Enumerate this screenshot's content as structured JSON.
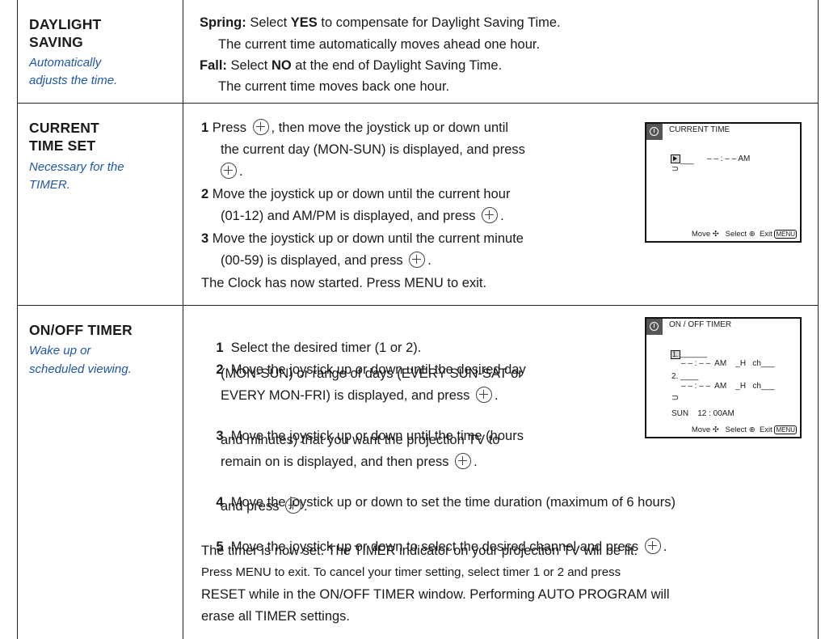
{
  "rows": {
    "daylight": {
      "title1": "DAYLIGHT",
      "title2": "SAVING",
      "sub1": "Automatically",
      "sub2": "adjusts the time.",
      "spring_label": "Spring:",
      "spring_a": " Select ",
      "spring_yes": "YES",
      "spring_b": " to compensate for Daylight Saving Time.",
      "spring_line2": "The current time automatically moves ahead one hour.",
      "fall_label": "Fall:",
      "fall_a": " Select ",
      "fall_no": "NO",
      "fall_b": " at the end of Daylight Saving Time.",
      "fall_line2": "The current time moves back one hour."
    },
    "current_time": {
      "title1": "CURRENT",
      "title2": "TIME SET",
      "sub1": "Necessary for the",
      "sub2": "TIMER.",
      "s1_num": "1",
      "s1_a": " Press ",
      "s1_b": ", then move the joystick up or down until",
      "s1_line2": "the current day (MON-SUN) is displayed, and press",
      "s1_line3": ".",
      "s2_num": "2",
      "s2_a": " Move the joystick up or down until the current hour",
      "s2_line2": "(01-12) and AM/PM is displayed, and press ",
      "s2_end": ".",
      "s3_num": "3",
      "s3_a": " Move the joystick up or down until the current minute",
      "s3_line2": "(00-59) is displayed, and press ",
      "s3_end": ".",
      "final": "The Clock has now started. Press MENU to exit.",
      "osd": {
        "title": "CURRENT TIME",
        "day": "___",
        "time": "– –  : – – AM",
        "return_glyph": "⊃",
        "move": "Move",
        "select": "Select",
        "exit": "Exit",
        "menu": "MENU"
      }
    },
    "onoff": {
      "title1": "ON/OFF TIMER",
      "sub1": "Wake up or",
      "sub2": "scheduled viewing.",
      "s1_num": "1",
      "s1_a": "  Select the desired timer (1 or 2).",
      "s2_num": "2",
      "s2_a": "  Move the joystick up or down until the desired day",
      "s2_line2": "(MON-SUN) or range of days (EVERY SUN-SAT or",
      "s2_line3": "EVERY MON-FRI) is displayed, and press ",
      "s2_end": ".",
      "s3_num": "3",
      "s3_a": "  Move the joystick up or down until the time (hours",
      "s3_line2": "and minutes) that you want the projection TV to",
      "s3_line3": "remain on is displayed, and then press ",
      "s3_end": ".",
      "s4_num": "4",
      "s4_a": "  Move the joystick up or down to set the time duration (maximum of 6 hours)",
      "s4_line2": "and press ",
      "s4_end": ".",
      "s5_num": "5",
      "s5_a": "  Move the joystick up or down to select the desired channel and press ",
      "s5_end": ".",
      "final1": "The timer is now set. The TIMER indicator on your projection TV will be lit.",
      "final2": "Press MENU to exit. To cancel your timer setting, select timer 1 or 2 and press",
      "final3": "RESET while in the ON/OFF TIMER window. Performing AUTO PROGRAM will",
      "final4": "erase all TIMER settings.",
      "osd": {
        "title": "ON / OFF TIMER",
        "t1_label": "1.",
        "t1_day": "______",
        "t1_line": "– – : – –  AM    _H   ch___",
        "t2_label": "2.",
        "t2_day": "____",
        "t2_line": "– – : – –  AM    _H   ch___",
        "return_glyph": "⊃",
        "clock": "SUN    12 : 00AM",
        "move": "Move",
        "select": "Select",
        "exit": "Exit",
        "menu": "MENU"
      }
    }
  }
}
